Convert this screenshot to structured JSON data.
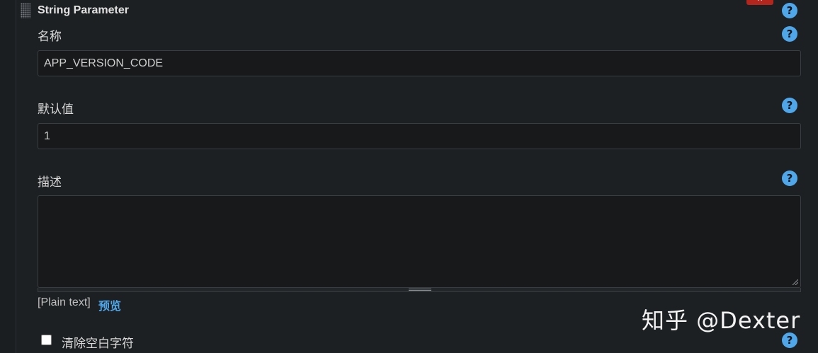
{
  "section": {
    "title": "String Parameter",
    "delete_label": "X"
  },
  "fields": {
    "name": {
      "label": "名称",
      "value": "APP_VERSION_CODE"
    },
    "default_value": {
      "label": "默认值",
      "value": "1"
    },
    "description": {
      "label": "描述",
      "value": ""
    }
  },
  "description_footer": {
    "format_text": "[Plain text]",
    "preview_label": "预览"
  },
  "trim": {
    "label": "清除空白字符",
    "checked": false
  },
  "help_glyph": "?",
  "watermark": "知乎 @Dexter",
  "colors": {
    "accent": "#4fa6e8",
    "delete": "#b3261e",
    "background": "#1d2023",
    "input_bg": "#18191b"
  }
}
